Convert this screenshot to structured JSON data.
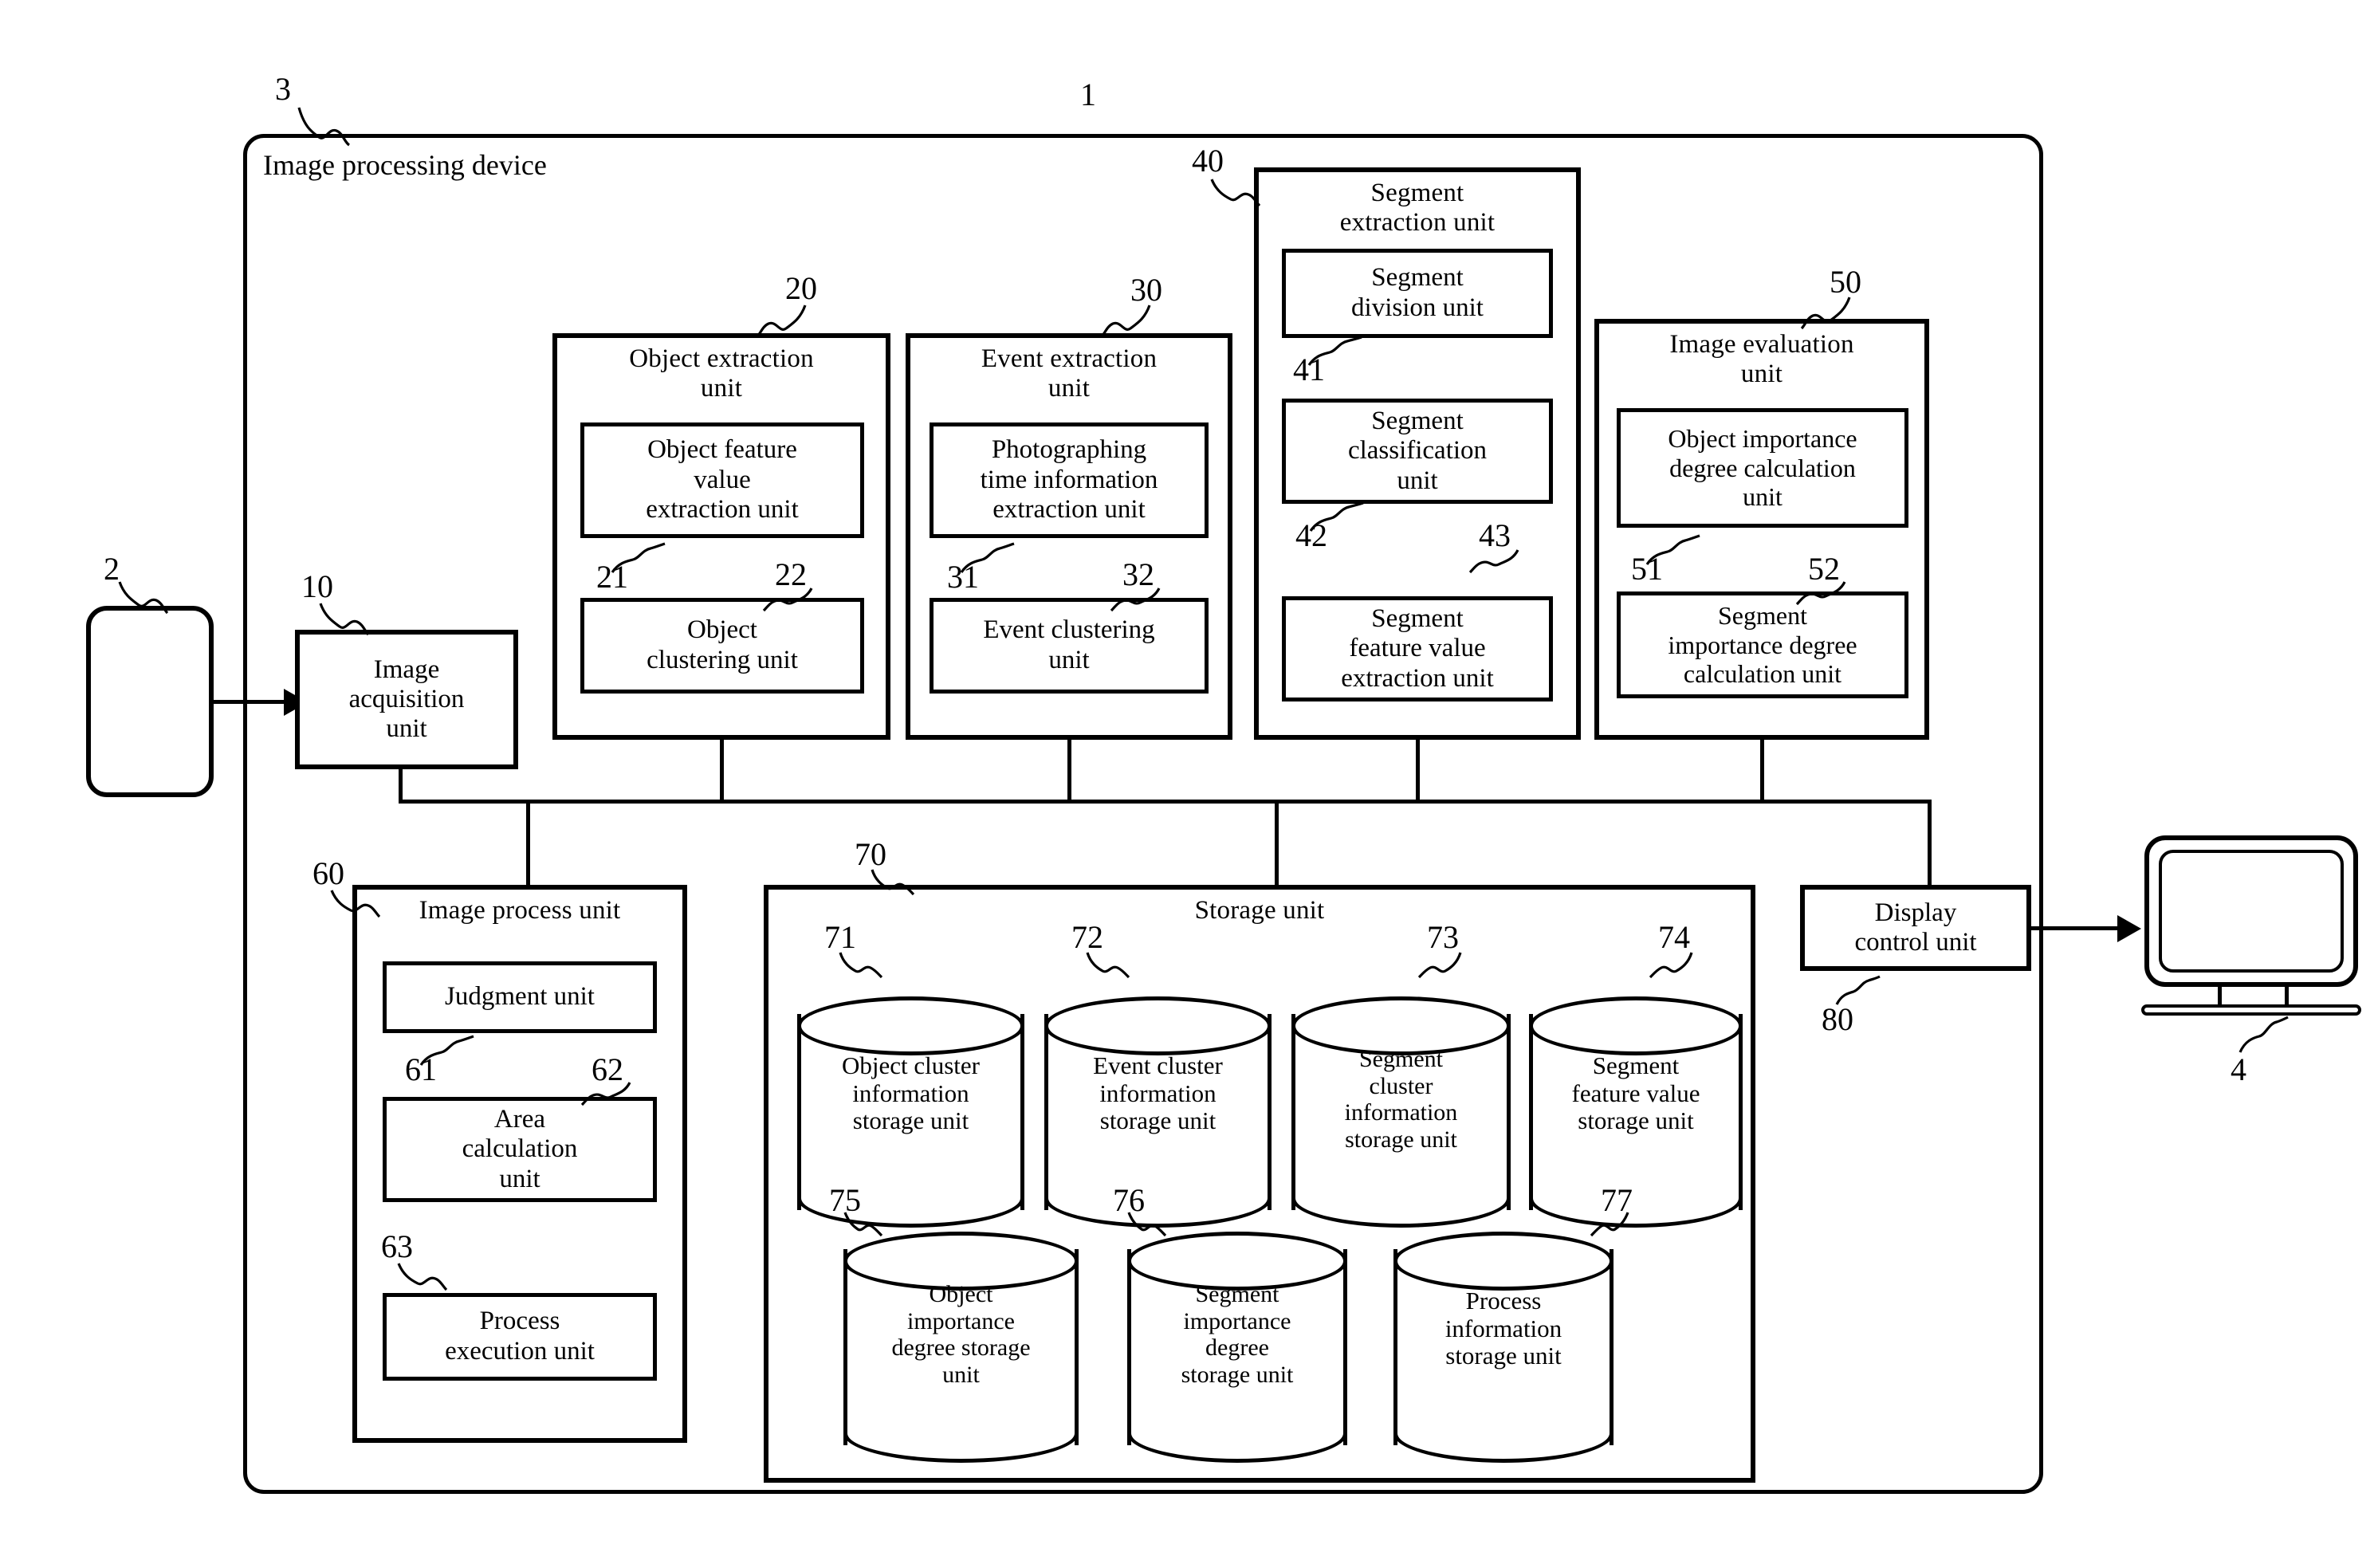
{
  "figure": {
    "system_ref": "1",
    "device_ref": "3",
    "device_title": "Image processing device",
    "input_device_ref": "2",
    "display_device_ref": "4"
  },
  "blocks": {
    "image_acquisition": {
      "ref": "10",
      "title": "Image\nacquisition\nunit"
    },
    "object_extraction": {
      "ref": "20",
      "title": "Object extraction\nunit",
      "children": [
        {
          "ref": "21",
          "title": "Object feature\nvalue\nextraction unit"
        },
        {
          "ref": "22",
          "title": "Object\nclustering unit"
        }
      ]
    },
    "event_extraction": {
      "ref": "30",
      "title": "Event extraction\nunit",
      "children": [
        {
          "ref": "31",
          "title": "Photographing\ntime information\nextraction unit"
        },
        {
          "ref": "32",
          "title": "Event clustering\nunit"
        }
      ]
    },
    "segment_extraction": {
      "ref": "40",
      "title": "Segment\nextraction unit",
      "children": [
        {
          "ref": "41",
          "title": "Segment\ndivision unit"
        },
        {
          "ref": "42",
          "title": "Segment\nclassification\nunit"
        },
        {
          "ref": "43",
          "title": "Segment\nfeature value\nextraction unit"
        }
      ]
    },
    "image_evaluation": {
      "ref": "50",
      "title": "Image evaluation\nunit",
      "children": [
        {
          "ref": "51",
          "title": "Object importance\ndegree calculation\nunit"
        },
        {
          "ref": "52",
          "title": "Segment\nimportance degree\ncalculation unit"
        }
      ]
    },
    "image_process": {
      "ref": "60",
      "title": "Image process unit",
      "children": [
        {
          "ref": "61",
          "title": "Judgment unit"
        },
        {
          "ref": "62",
          "title": "Area\ncalculation\nunit"
        },
        {
          "ref": "63",
          "title": "Process\nexecution unit"
        }
      ]
    },
    "storage": {
      "ref": "70",
      "title": "Storage unit",
      "stores_row1": [
        {
          "ref": "71",
          "title": "Object cluster\ninformation\nstorage unit"
        },
        {
          "ref": "72",
          "title": "Event cluster\ninformation\nstorage unit"
        },
        {
          "ref": "73",
          "title": "Segment\ncluster\ninformation\nstorage unit"
        },
        {
          "ref": "74",
          "title": "Segment\nfeature value\nstorage unit"
        }
      ],
      "stores_row2": [
        {
          "ref": "75",
          "title": "Object\nimportance\ndegree storage\nunit"
        },
        {
          "ref": "76",
          "title": "Segment\nimportance\ndegree\nstorage unit"
        },
        {
          "ref": "77",
          "title": "Process\ninformation\nstorage unit"
        }
      ]
    },
    "display_control": {
      "ref": "80",
      "title": "Display\ncontrol unit"
    }
  }
}
